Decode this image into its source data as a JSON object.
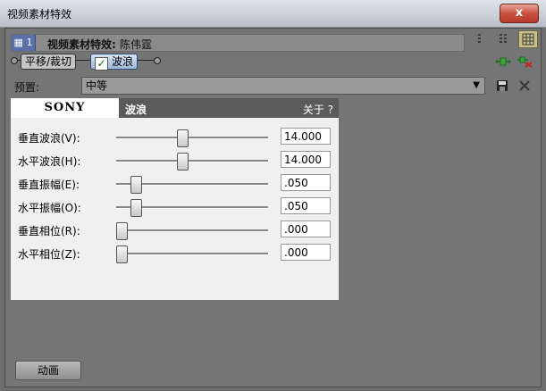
{
  "window": {
    "title": "视频素材特效",
    "close_glyph": "x"
  },
  "header": {
    "chain_number": "1",
    "title_label": "视频素材特效:",
    "media_name": "陈伟霆"
  },
  "chain": {
    "items": [
      {
        "label": "平移/裁切",
        "checked": false,
        "active": false
      },
      {
        "label": "波浪",
        "checked": true,
        "active": true
      }
    ]
  },
  "preset": {
    "label": "预置:",
    "selected": "中等"
  },
  "panel": {
    "brand": "SONY",
    "name": "波浪",
    "about": "关于 ?",
    "params": [
      {
        "label": "垂直波浪(V):",
        "value": "14.000",
        "level": 0.43
      },
      {
        "label": "水平波浪(H):",
        "value": "14.000",
        "level": 0.43
      },
      {
        "label": "垂直振幅(E):",
        "value": ".050",
        "level": 0.1
      },
      {
        "label": "水平振幅(O):",
        "value": ".050",
        "level": 0.1
      },
      {
        "label": "垂直相位(R):",
        "value": ".000",
        "level": 0.0
      },
      {
        "label": "水平相位(Z):",
        "value": ".000",
        "level": 0.0
      }
    ]
  },
  "footer": {
    "animate_label": "动画"
  },
  "colors": {
    "background": "#757575",
    "panel": "#f0f0f0",
    "active_tab": "#9fb7d8",
    "close_button": "#c9503f"
  }
}
